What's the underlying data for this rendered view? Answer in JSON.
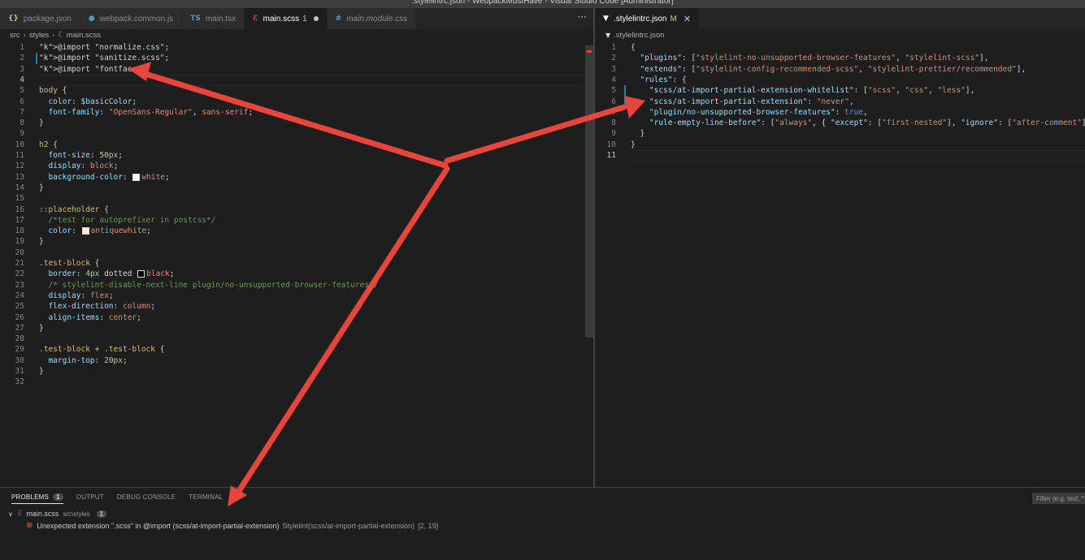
{
  "window": {
    "title": ".stylelintrc.json - WebpackMustHave - Visual Studio Code [Administrator]"
  },
  "left_tabs": [
    {
      "label": "package.json",
      "icon": "{}",
      "icon_color": "#cbcb41",
      "state": ""
    },
    {
      "label": "webpack.common.js",
      "icon": "●",
      "icon_color": "#519aba",
      "state": ""
    },
    {
      "label": "main.tsx",
      "icon": "TS",
      "icon_color": "#519aba",
      "state": ""
    },
    {
      "label": "main.scss",
      "icon": "ℰ",
      "icon_color": "#f55385",
      "state": "1",
      "active": true
    },
    {
      "label": "main.module.css",
      "icon": "#",
      "icon_color": "#519aba",
      "state": "",
      "italic": true
    }
  ],
  "right_tabs": [
    {
      "label": ".stylelintrc.json",
      "icon": "▼",
      "icon_color": "#ffffff",
      "state": "M",
      "active": true
    }
  ],
  "more_actions": "···",
  "left_breadcrumb": [
    "src",
    "styles",
    "main.scss"
  ],
  "right_breadcrumb": [
    ".stylelintrc.json"
  ],
  "scss_lines": [
    "@import \"normalize.css\";",
    "@import \"sanitize.scss\";",
    "@import \"fontface\";",
    "",
    "body {",
    "  color: $basicColor;",
    "  font-family: \"OpenSans-Regular\", sans-serif;",
    "}",
    "",
    "h2 {",
    "  font-size: 50px;",
    "  display: block;",
    "  background-color: white;",
    "}",
    "",
    "::placeholder {",
    "  /*test for autoprefixer in postcss*/",
    "  color: antiquewhite;",
    "}",
    "",
    ".test-block {",
    "  border: 4px dotted black;",
    "  /* stylelint-disable-next-line plugin/no-unsupported-browser-features*/",
    "  display: flex;",
    "  flex-direction: column;",
    "  align-items: center;",
    "}",
    "",
    ".test-block + .test-block {",
    "  margin-top: 20px;",
    "}",
    ""
  ],
  "json_lines": [
    "{",
    "  \"plugins\": [\"stylelint-no-unsupported-browser-features\", \"stylelint-scss\"],",
    "  \"extends\": [\"stylelint-config-recommended-scss\", \"stylelint-prettier/recommended\"],",
    "  \"rules\": {",
    "    \"scss/at-import-partial-extension-whitelist\": [\"scss\", \"css\", \"less\"],",
    "    \"scss/at-import-partial-extension\": \"never\",",
    "    \"plugin/no-unsupported-browser-features\": true,",
    "    \"rule-empty-line-before\": [\"always\", { \"except\": [\"first-nested\"], \"ignore\": [\"after-comment\"] }]",
    "  }",
    "}",
    ""
  ],
  "panel": {
    "tabs": [
      "PROBLEMS",
      "OUTPUT",
      "DEBUG CONSOLE",
      "TERMINAL"
    ],
    "problems_count": "1",
    "filter_placeholder": "Filter (e.g. text, **/*.ts, !**/node_modules/**)",
    "file": {
      "name": "main.scss",
      "path": "src\\styles",
      "count": "1"
    },
    "problem": {
      "message": "Unexpected extension \".scss\" in @import (scss/at-import-partial-extension)",
      "source": "Stylelint(scss/at-import-partial-extension)",
      "location": "[2, 19]"
    }
  },
  "colors": {
    "accent": "#007acc",
    "error": "#f14c4c",
    "arrow": "#e8453c"
  }
}
